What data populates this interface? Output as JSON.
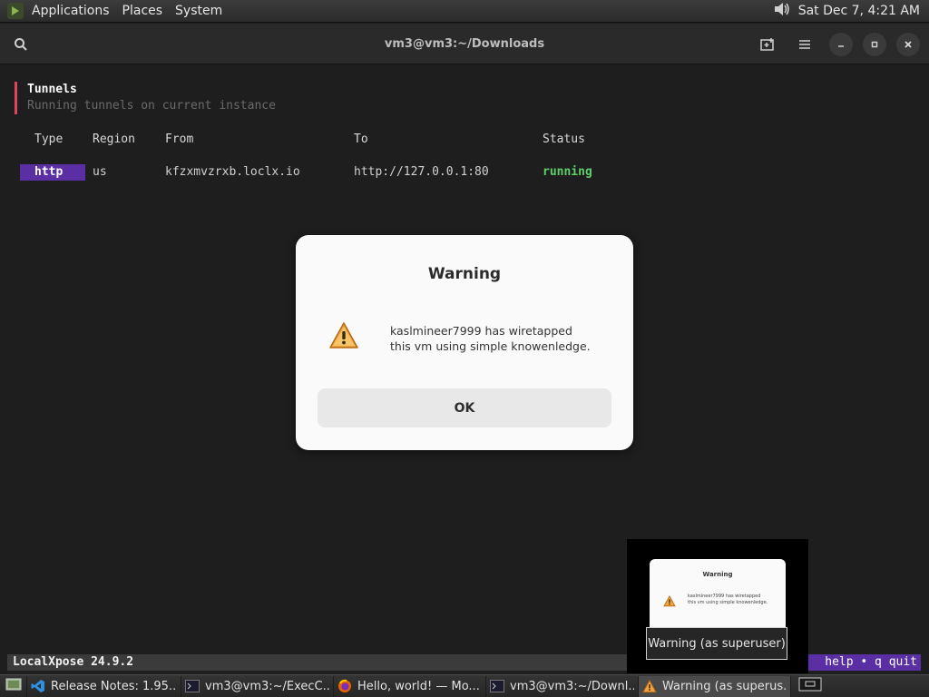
{
  "top_panel": {
    "menus": [
      "Applications",
      "Places",
      "System"
    ],
    "clock": "Sat Dec  7,  4:21 AM"
  },
  "terminal": {
    "title": "vm3@vm3:~/Downloads",
    "section_title": "Tunnels",
    "section_subtitle": "Running tunnels on current instance",
    "columns": [
      "Type",
      "Region",
      "From",
      "To",
      "Status"
    ],
    "row": {
      "type": "http",
      "region": "us",
      "from": "kfzxmvzrxb.loclx.io",
      "to": "http://127.0.0.1:80",
      "status": "running"
    },
    "status_left": "LocalXpose 24.9.2",
    "status_right": "help • q quit"
  },
  "dialog": {
    "title": "Warning",
    "message_line1": "kaslmineer7999 has wiretapped",
    "message_line2": "this vm using simple knowenledge.",
    "ok_label": "OK",
    "icon": "warning-icon"
  },
  "preview": {
    "title": "Warning",
    "message_line1": "kaslmineer7999 has wiretapped",
    "message_line2": "this vm using simple knowenledge.",
    "tooltip": "Warning (as superuser)"
  },
  "taskbar": {
    "items": [
      {
        "label": "Release Notes: 1.95....",
        "icon": "vscode-icon"
      },
      {
        "label": "vm3@vm3:~/ExecC...",
        "icon": "terminal-icon"
      },
      {
        "label": "Hello, world! — Mo...",
        "icon": "firefox-icon"
      },
      {
        "label": "vm3@vm3:~/Downl...",
        "icon": "terminal-icon"
      },
      {
        "label": "Warning (as superus...",
        "icon": "warning-icon"
      }
    ]
  },
  "colors": {
    "accent_purple": "#5a2fa3",
    "status_green": "#5fcf6a",
    "tunnel_bar_red": "#e0455b"
  }
}
